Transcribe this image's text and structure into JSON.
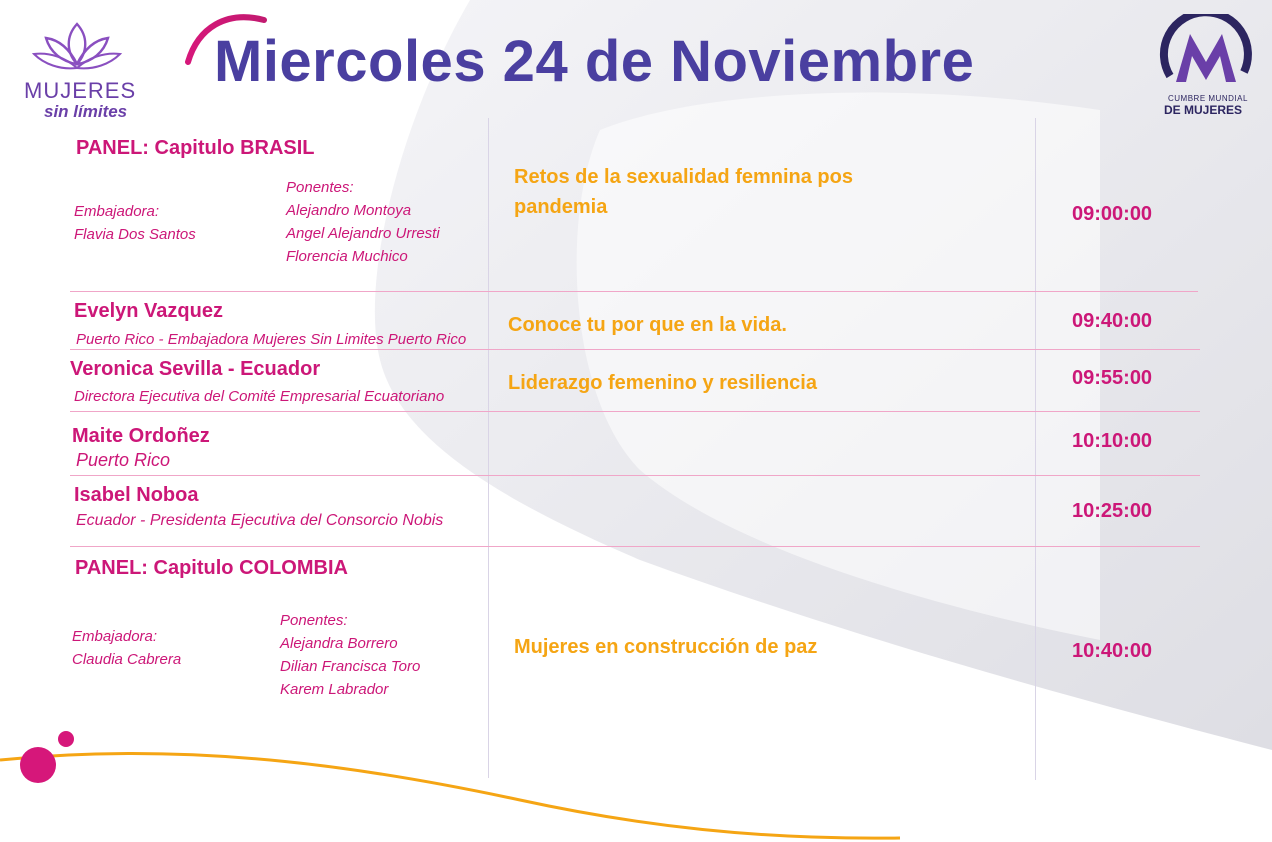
{
  "header": {
    "title": "Miercoles 24 de Noviembre",
    "logo_left": {
      "line1": "MUJERES",
      "line2": "sin límites"
    },
    "logo_right": {
      "line1": "CUMBRE MUNDIAL",
      "line2": "DE MUJERES"
    }
  },
  "rows": [
    {
      "panel_title": "PANEL: Capitulo BRASIL",
      "ambassador_label": "Embajadora:",
      "ambassador_name": "Flavia Dos Santos",
      "speakers_label": "Ponentes:",
      "speakers": [
        "Alejandro Montoya",
        "Angel Alejandro Urresti",
        "Florencia Muchico"
      ],
      "topic_line1": "Retos de la sexualidad femnina pos",
      "topic_line2": "pandemia",
      "time": "09:00:00"
    },
    {
      "name": "Evelyn Vazquez",
      "detail": "Puerto Rico - Embajadora Mujeres Sin Limites Puerto Rico",
      "topic": "Conoce tu por que en la vida.",
      "time": "09:40:00"
    },
    {
      "name": "Veronica Sevilla - Ecuador",
      "detail": "Directora Ejecutiva del Comité Empresarial Ecuatoriano",
      "topic": "Liderazgo femenino y resiliencia",
      "time": "09:55:00"
    },
    {
      "name": "Maite Ordoñez",
      "detail": "Puerto Rico",
      "topic": "",
      "time": "10:10:00"
    },
    {
      "name": "Isabel Noboa",
      "detail": "Ecuador -  Presidenta Ejecutiva del Consorcio Nobis",
      "topic": "",
      "time": "10:25:00"
    },
    {
      "panel_title": "PANEL: Capitulo COLOMBIA",
      "ambassador_label": "Embajadora:",
      "ambassador_name": "Claudia Cabrera",
      "speakers_label": "Ponentes:",
      "speakers": [
        "Alejandra Borrero",
        "Dilian Francisca Toro",
        "Karem Labrador"
      ],
      "topic": "Mujeres en construcción de paz",
      "time": "10:40:00"
    }
  ],
  "colors": {
    "magenta": "#cc1778",
    "purple": "#4a3fa0",
    "orange": "#f5a514",
    "divider": "#f0a6c8"
  }
}
